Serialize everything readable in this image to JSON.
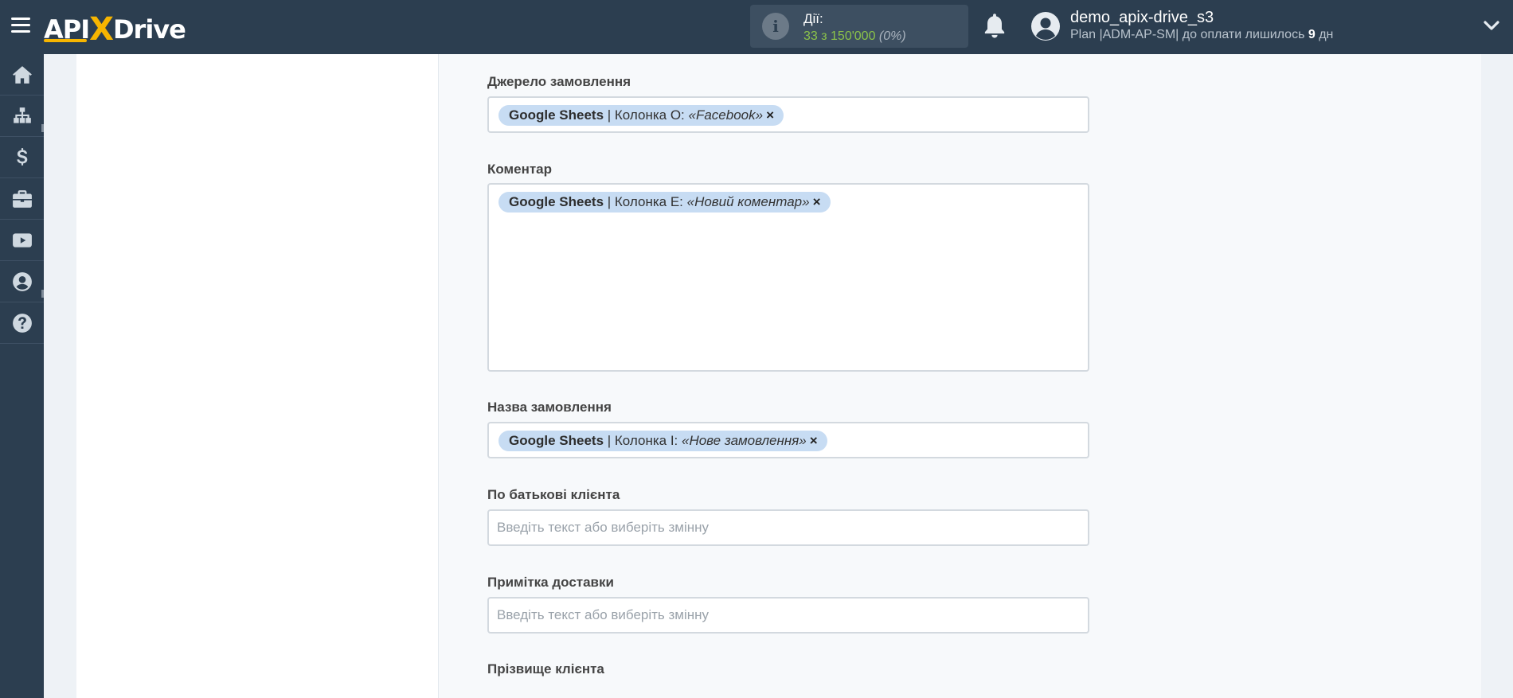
{
  "header": {
    "logo_api": "API",
    "logo_x": "X",
    "logo_drive": "Drive",
    "actions_label": "Дії:",
    "actions_count": "33 з 150'000",
    "actions_percent": "(0%)",
    "account_name": "demo_apix-drive_s3",
    "plan_prefix": "Plan |ADM-AP-SM| до оплати лишилось ",
    "plan_days": "9",
    "plan_suffix": " дн"
  },
  "sidebar": {
    "items": [
      {
        "icon": "home-icon"
      },
      {
        "icon": "sitemap-icon"
      },
      {
        "icon": "dollar-icon"
      },
      {
        "icon": "briefcase-icon"
      },
      {
        "icon": "youtube-icon"
      },
      {
        "icon": "user-circle-icon"
      },
      {
        "icon": "question-icon"
      }
    ]
  },
  "form": {
    "source": {
      "label": "Джерело замовлення",
      "chip_app": "Google Sheets",
      "chip_col": " | Колонка O: ",
      "chip_val": "«Facebook»",
      "remove": "×"
    },
    "comment": {
      "label": "Коментар",
      "chip_app": "Google Sheets",
      "chip_col": " | Колонка E: ",
      "chip_val": "«Новий коментар»",
      "remove": "×"
    },
    "order_name": {
      "label": "Назва замовлення",
      "chip_app": "Google Sheets",
      "chip_col": " | Колонка I: ",
      "chip_val": "«Нове замовлення»",
      "remove": "×"
    },
    "patronymic": {
      "label": "По батькові клієнта",
      "placeholder": "Введіть текст або виберіть змінну"
    },
    "delivery_note": {
      "label": "Примітка доставки",
      "placeholder": "Введіть текст або виберіть змінну"
    },
    "last_name": {
      "label": "Прізвище клієнта"
    }
  }
}
